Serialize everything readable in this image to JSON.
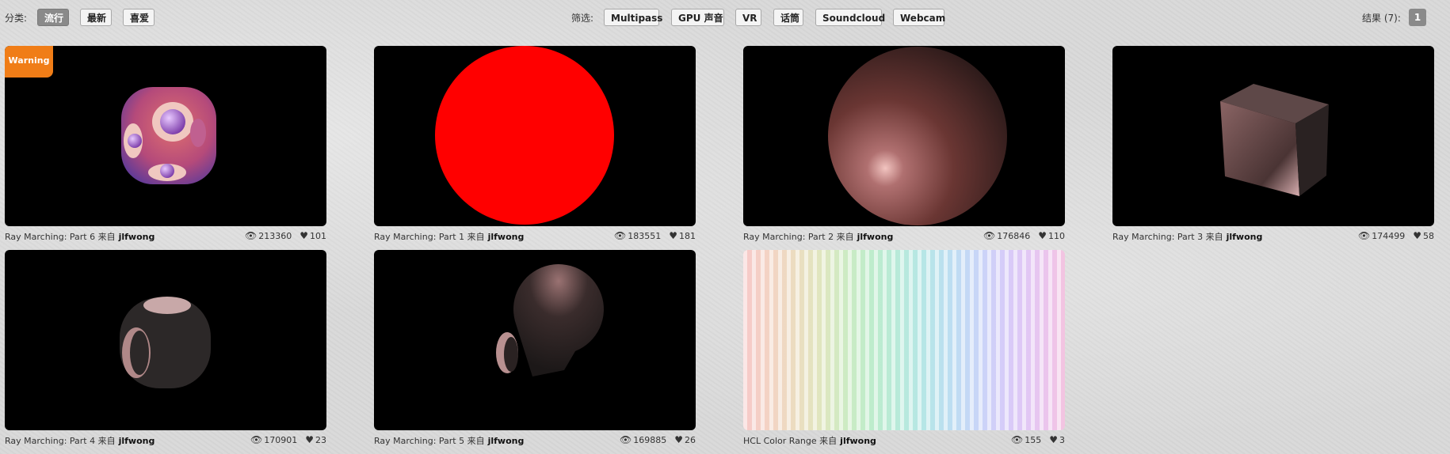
{
  "topbar": {
    "category_label": "分类:",
    "categories": [
      "流行",
      "最新",
      "喜爱"
    ],
    "filter_label": "筛选:",
    "filters": [
      "Multipass",
      "GPU 声音",
      "VR",
      "话筒",
      "Soundcloud",
      "Webcam"
    ],
    "results_label": "结果 (7):",
    "page": "1"
  },
  "warning_label": "Warning",
  "from_label": "来自",
  "cards": [
    {
      "title": "Ray Marching: Part 6",
      "author": "jlfwong",
      "views": "213360",
      "likes": "101",
      "thumb": "dice-sphere",
      "warning": true
    },
    {
      "title": "Ray Marching: Part 1",
      "author": "jlfwong",
      "views": "183551",
      "likes": "181",
      "thumb": "red-sphere"
    },
    {
      "title": "Ray Marching: Part 2",
      "author": "jlfwong",
      "views": "176846",
      "likes": "110",
      "thumb": "shaded-sphere"
    },
    {
      "title": "Ray Marching: Part 3",
      "author": "jlfwong",
      "views": "174499",
      "likes": "58",
      "thumb": "cube"
    },
    {
      "title": "Ray Marching: Part 4",
      "author": "jlfwong",
      "views": "170901",
      "likes": "23",
      "thumb": "hollow-sphere-cube"
    },
    {
      "title": "Ray Marching: Part 5",
      "author": "jlfwong",
      "views": "169885",
      "likes": "26",
      "thumb": "cut-sphere"
    },
    {
      "title": "HCL Color Range",
      "author": "jlfwong",
      "views": "155",
      "likes": "3",
      "thumb": "hcl-stripes"
    }
  ],
  "icons": {
    "views": "eye-icon",
    "likes": "heart-icon"
  }
}
